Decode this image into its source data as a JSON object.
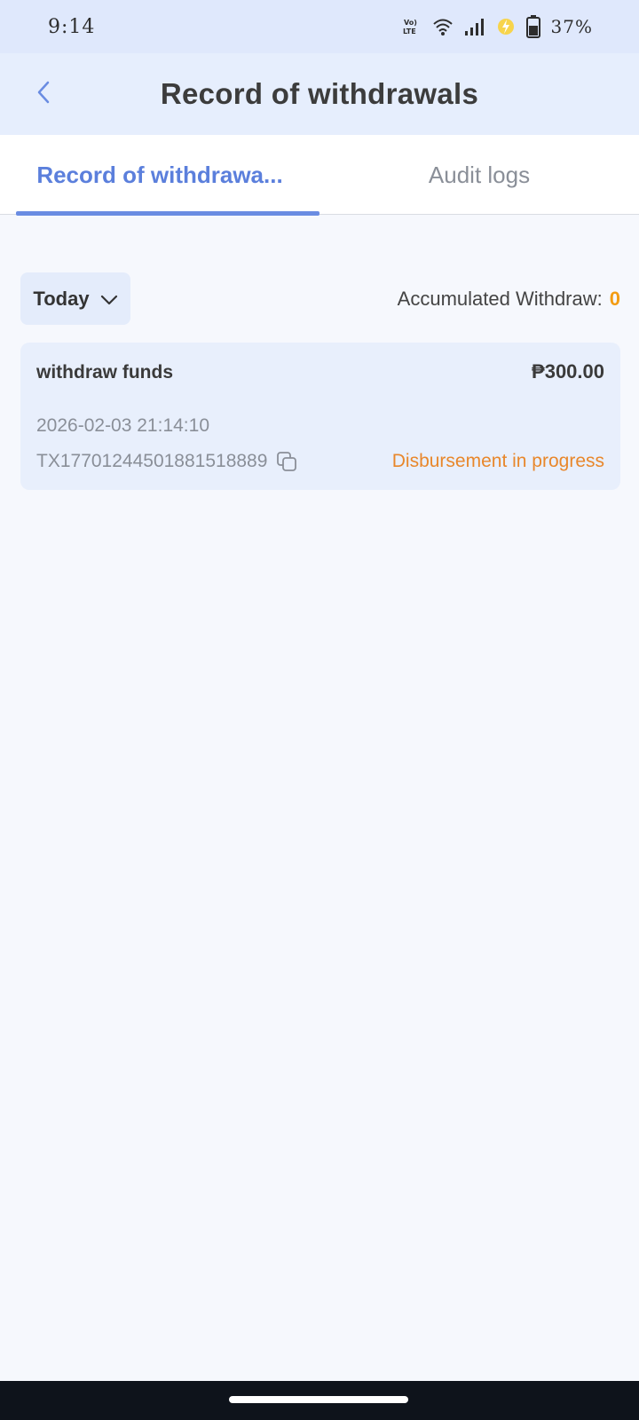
{
  "status_bar": {
    "time": "9:14",
    "network_badge": "Vo) LTE",
    "battery_percent": "37%",
    "icons": [
      "volte-icon",
      "wifi-icon",
      "signal-icon",
      "charging-icon",
      "battery-icon"
    ]
  },
  "header": {
    "title": "Record of withdrawals",
    "back_icon": "chevron-left-icon"
  },
  "tabs": [
    {
      "label": "Record of withdrawa...",
      "active": true
    },
    {
      "label": "Audit logs",
      "active": false
    }
  ],
  "filter": {
    "selected": "Today",
    "accumulated_label": "Accumulated Withdraw:",
    "accumulated_value": "0"
  },
  "records": [
    {
      "title": "withdraw funds",
      "amount": "₱300.00",
      "datetime": "2026-02-03 21:14:10",
      "transaction_id": "TX17701244501881518889",
      "status": "Disbursement in progress"
    }
  ],
  "colors": {
    "accent": "#5b7fdc",
    "status_pending": "#e8872b",
    "accumulated_value": "#f39c12",
    "header_bg": "#e6eefd",
    "card_bg": "#e8effc"
  }
}
